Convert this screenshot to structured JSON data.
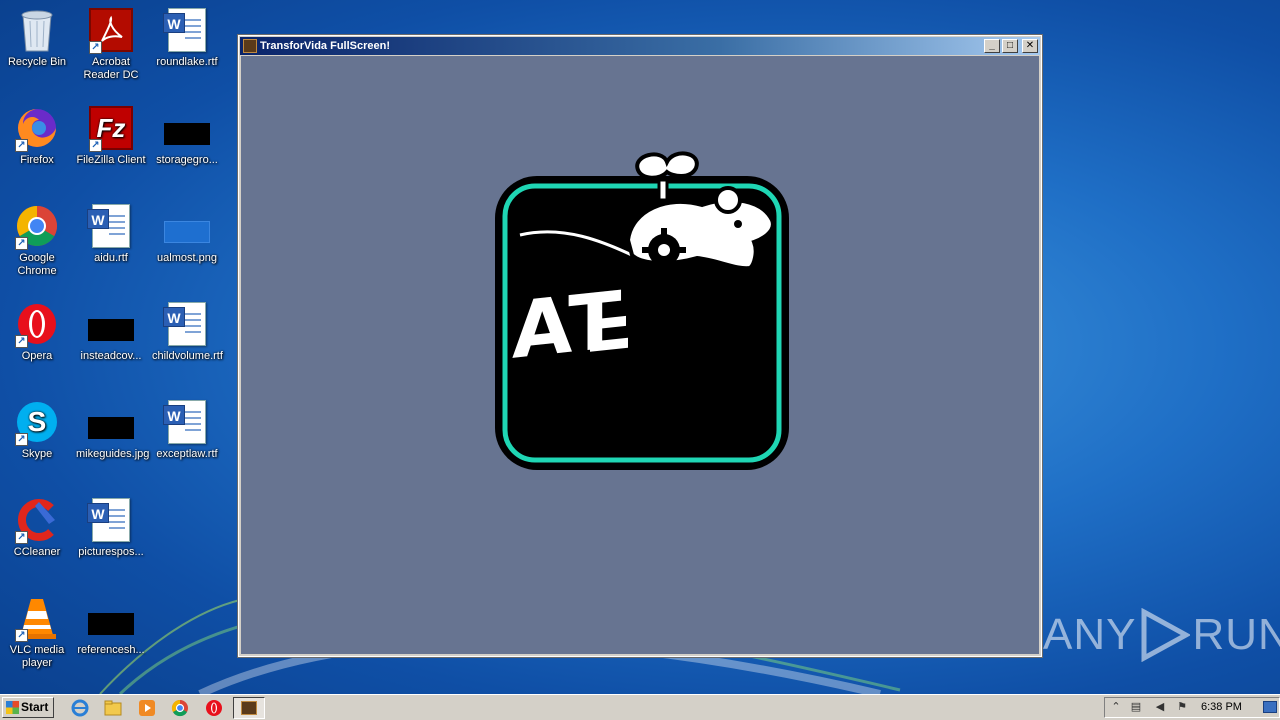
{
  "desktop": {
    "icons": [
      {
        "label": "Recycle Bin"
      },
      {
        "label": "Acrobat Reader DC"
      },
      {
        "label": "roundlake.rtf"
      },
      {
        "label": "Firefox"
      },
      {
        "label": "FileZilla Client"
      },
      {
        "label": "storagegro..."
      },
      {
        "label": "Google Chrome"
      },
      {
        "label": "aidu.rtf"
      },
      {
        "label": "ualmost.png"
      },
      {
        "label": "Opera"
      },
      {
        "label": "insteadcov..."
      },
      {
        "label": "childvolume.rtf"
      },
      {
        "label": "Skype"
      },
      {
        "label": "mikeguides.jpg"
      },
      {
        "label": "exceptlaw.rtf"
      },
      {
        "label": "CCleaner"
      },
      {
        "label": "picturespos..."
      },
      {
        "label": "VLC media player"
      },
      {
        "label": "referencesh..."
      }
    ]
  },
  "window": {
    "title": "TransforVida FullScreen!",
    "logo_text": "AT",
    "client_bg": "#677491"
  },
  "watermark": {
    "left": "ANY",
    "right": "RUN"
  },
  "taskbar": {
    "start_label": "Start",
    "clock": "6:38 PM"
  },
  "colors": {
    "accent": "#1fd6b4",
    "titlebar": "#0a246a"
  }
}
